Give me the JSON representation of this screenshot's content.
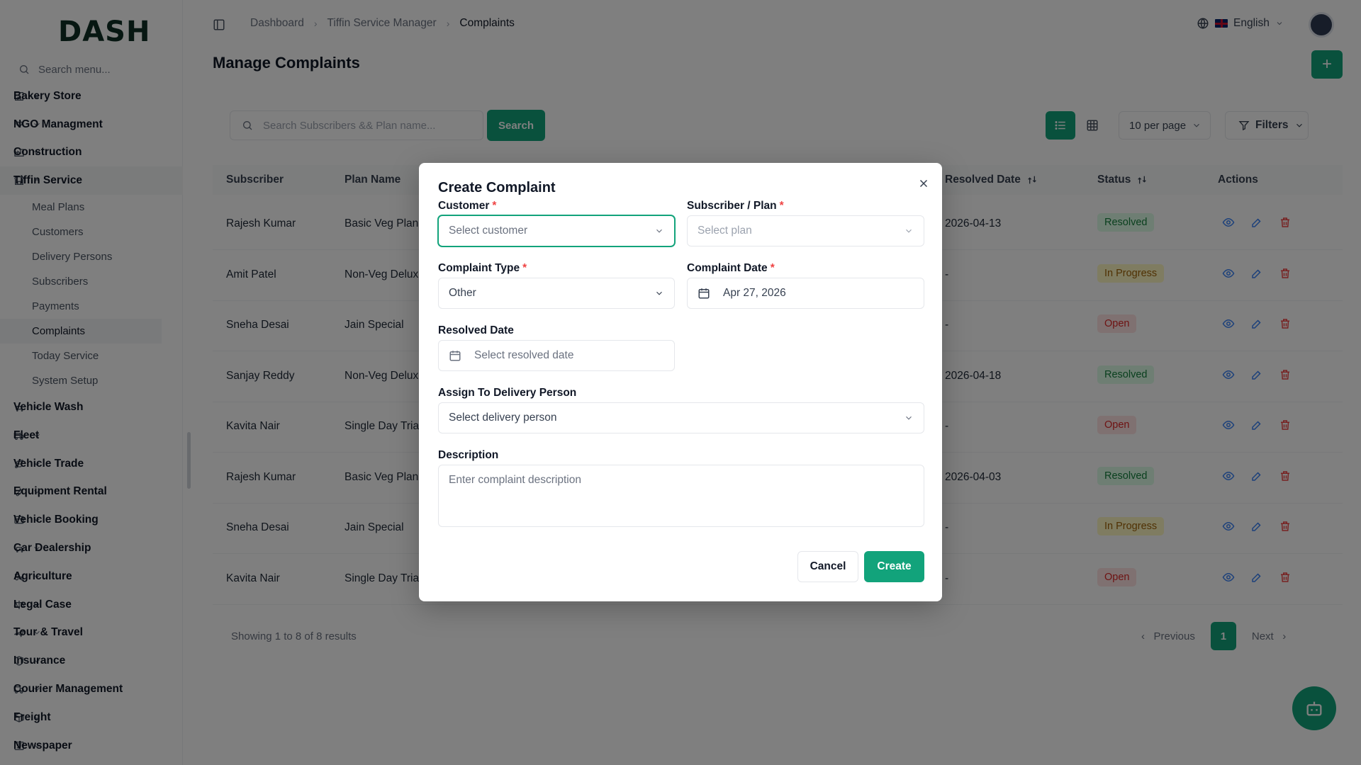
{
  "app": {
    "logo": "DASH"
  },
  "sidebar": {
    "search_placeholder": "Search menu...",
    "items": [
      {
        "label": "Bakery Store",
        "icon": "store-icon"
      },
      {
        "label": "NGO Managment",
        "icon": "hand-heart-icon"
      },
      {
        "label": "Construction",
        "icon": "factory-icon"
      },
      {
        "label": "Tiffin Service",
        "icon": "store-icon",
        "open": true
      },
      {
        "label": "Vehicle Wash",
        "icon": "car-icon"
      },
      {
        "label": "Fleet",
        "icon": "truck-icon"
      },
      {
        "label": "Vehicle Trade",
        "icon": "route-icon"
      },
      {
        "label": "Equipment Rental",
        "icon": "wrench-icon"
      },
      {
        "label": "Vehicle Booking",
        "icon": "booking-icon"
      },
      {
        "label": "Car Dealership",
        "icon": "car-icon"
      },
      {
        "label": "Agriculture",
        "icon": "tractor-icon"
      },
      {
        "label": "Legal Case",
        "icon": "scale-icon"
      },
      {
        "label": "Tour & Travel",
        "icon": "plane-icon"
      },
      {
        "label": "Insurance",
        "icon": "shield-icon"
      },
      {
        "label": "Courier Management",
        "icon": "truck-icon"
      },
      {
        "label": "Freight",
        "icon": "package-icon"
      },
      {
        "label": "Newspaper",
        "icon": "newspaper-icon"
      }
    ],
    "sub_items": [
      "Meal Plans",
      "Customers",
      "Delivery Persons",
      "Subscribers",
      "Payments",
      "Complaints",
      "Today Service",
      "System Setup"
    ],
    "active_sub": "Complaints"
  },
  "header": {
    "breadcrumbs": [
      "Dashboard",
      "Tiffin Service Manager",
      "Complaints"
    ],
    "language": "English"
  },
  "page": {
    "title": "Manage Complaints",
    "search_placeholder": "Search Subscribers && Plan name...",
    "search_button": "Search",
    "per_page": "10 per page",
    "filters_label": "Filters"
  },
  "table": {
    "columns": {
      "subscriber": "Subscriber",
      "plan_name": "Plan Name",
      "resolved_date": "Resolved Date",
      "status": "Status",
      "actions": "Actions"
    },
    "rows": [
      {
        "subscriber": "Rajesh Kumar",
        "plan": "Basic Veg Plan",
        "resolved": "2026-04-13",
        "status": "Resolved"
      },
      {
        "subscriber": "Amit Patel",
        "plan": "Non-Veg Delux",
        "resolved": "-",
        "status": "In Progress"
      },
      {
        "subscriber": "Sneha Desai",
        "plan": "Jain Special",
        "resolved": "-",
        "status": "Open"
      },
      {
        "subscriber": "Sanjay Reddy",
        "plan": "Non-Veg Delux",
        "resolved": "2026-04-18",
        "status": "Resolved"
      },
      {
        "subscriber": "Kavita Nair",
        "plan": "Single Day Trial",
        "resolved": "-",
        "status": "Open"
      },
      {
        "subscriber": "Rajesh Kumar",
        "plan": "Basic Veg Plan",
        "resolved": "2026-04-03",
        "status": "Resolved"
      },
      {
        "subscriber": "Sneha Desai",
        "plan": "Jain Special",
        "resolved": "-",
        "status": "In Progress"
      },
      {
        "subscriber": "Kavita Nair",
        "plan": "Single Day Trial",
        "resolved": "-",
        "status": "Open"
      }
    ],
    "showing": "Showing 1 to 8 of 8 results",
    "pagination": {
      "previous": "Previous",
      "page": "1",
      "next": "Next"
    }
  },
  "modal": {
    "title": "Create Complaint",
    "customer_label": "Customer",
    "customer_placeholder": "Select customer",
    "plan_label": "Subscriber / Plan",
    "plan_placeholder": "Select plan",
    "type_label": "Complaint Type",
    "type_value": "Other",
    "date_label": "Complaint Date",
    "date_value": "Apr 27, 2026",
    "resolved_label": "Resolved Date",
    "resolved_placeholder": "Select resolved date",
    "assign_label": "Assign To Delivery Person",
    "assign_placeholder": "Select delivery person",
    "description_label": "Description",
    "description_placeholder": "Enter complaint description",
    "required_mark": "*",
    "cancel": "Cancel",
    "create": "Create"
  },
  "colors": {
    "accent": "#12a37b"
  }
}
